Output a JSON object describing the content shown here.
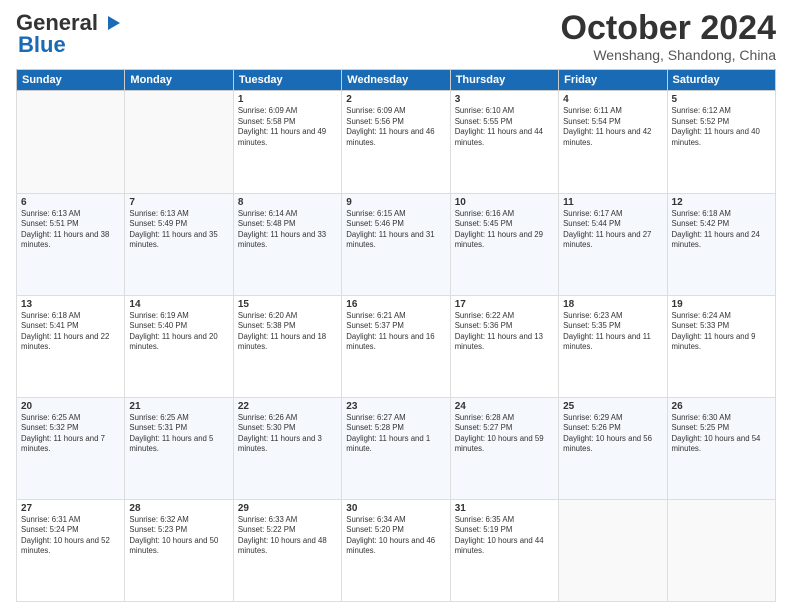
{
  "logo": {
    "general": "General",
    "blue": "Blue",
    "icon": "▶"
  },
  "header": {
    "month_title": "October 2024",
    "subtitle": "Wenshang, Shandong, China"
  },
  "days_of_week": [
    "Sunday",
    "Monday",
    "Tuesday",
    "Wednesday",
    "Thursday",
    "Friday",
    "Saturday"
  ],
  "weeks": [
    [
      {
        "day": "",
        "sunrise": "",
        "sunset": "",
        "daylight": ""
      },
      {
        "day": "",
        "sunrise": "",
        "sunset": "",
        "daylight": ""
      },
      {
        "day": "1",
        "sunrise": "Sunrise: 6:09 AM",
        "sunset": "Sunset: 5:58 PM",
        "daylight": "Daylight: 11 hours and 49 minutes."
      },
      {
        "day": "2",
        "sunrise": "Sunrise: 6:09 AM",
        "sunset": "Sunset: 5:56 PM",
        "daylight": "Daylight: 11 hours and 46 minutes."
      },
      {
        "day": "3",
        "sunrise": "Sunrise: 6:10 AM",
        "sunset": "Sunset: 5:55 PM",
        "daylight": "Daylight: 11 hours and 44 minutes."
      },
      {
        "day": "4",
        "sunrise": "Sunrise: 6:11 AM",
        "sunset": "Sunset: 5:54 PM",
        "daylight": "Daylight: 11 hours and 42 minutes."
      },
      {
        "day": "5",
        "sunrise": "Sunrise: 6:12 AM",
        "sunset": "Sunset: 5:52 PM",
        "daylight": "Daylight: 11 hours and 40 minutes."
      }
    ],
    [
      {
        "day": "6",
        "sunrise": "Sunrise: 6:13 AM",
        "sunset": "Sunset: 5:51 PM",
        "daylight": "Daylight: 11 hours and 38 minutes."
      },
      {
        "day": "7",
        "sunrise": "Sunrise: 6:13 AM",
        "sunset": "Sunset: 5:49 PM",
        "daylight": "Daylight: 11 hours and 35 minutes."
      },
      {
        "day": "8",
        "sunrise": "Sunrise: 6:14 AM",
        "sunset": "Sunset: 5:48 PM",
        "daylight": "Daylight: 11 hours and 33 minutes."
      },
      {
        "day": "9",
        "sunrise": "Sunrise: 6:15 AM",
        "sunset": "Sunset: 5:46 PM",
        "daylight": "Daylight: 11 hours and 31 minutes."
      },
      {
        "day": "10",
        "sunrise": "Sunrise: 6:16 AM",
        "sunset": "Sunset: 5:45 PM",
        "daylight": "Daylight: 11 hours and 29 minutes."
      },
      {
        "day": "11",
        "sunrise": "Sunrise: 6:17 AM",
        "sunset": "Sunset: 5:44 PM",
        "daylight": "Daylight: 11 hours and 27 minutes."
      },
      {
        "day": "12",
        "sunrise": "Sunrise: 6:18 AM",
        "sunset": "Sunset: 5:42 PM",
        "daylight": "Daylight: 11 hours and 24 minutes."
      }
    ],
    [
      {
        "day": "13",
        "sunrise": "Sunrise: 6:18 AM",
        "sunset": "Sunset: 5:41 PM",
        "daylight": "Daylight: 11 hours and 22 minutes."
      },
      {
        "day": "14",
        "sunrise": "Sunrise: 6:19 AM",
        "sunset": "Sunset: 5:40 PM",
        "daylight": "Daylight: 11 hours and 20 minutes."
      },
      {
        "day": "15",
        "sunrise": "Sunrise: 6:20 AM",
        "sunset": "Sunset: 5:38 PM",
        "daylight": "Daylight: 11 hours and 18 minutes."
      },
      {
        "day": "16",
        "sunrise": "Sunrise: 6:21 AM",
        "sunset": "Sunset: 5:37 PM",
        "daylight": "Daylight: 11 hours and 16 minutes."
      },
      {
        "day": "17",
        "sunrise": "Sunrise: 6:22 AM",
        "sunset": "Sunset: 5:36 PM",
        "daylight": "Daylight: 11 hours and 13 minutes."
      },
      {
        "day": "18",
        "sunrise": "Sunrise: 6:23 AM",
        "sunset": "Sunset: 5:35 PM",
        "daylight": "Daylight: 11 hours and 11 minutes."
      },
      {
        "day": "19",
        "sunrise": "Sunrise: 6:24 AM",
        "sunset": "Sunset: 5:33 PM",
        "daylight": "Daylight: 11 hours and 9 minutes."
      }
    ],
    [
      {
        "day": "20",
        "sunrise": "Sunrise: 6:25 AM",
        "sunset": "Sunset: 5:32 PM",
        "daylight": "Daylight: 11 hours and 7 minutes."
      },
      {
        "day": "21",
        "sunrise": "Sunrise: 6:25 AM",
        "sunset": "Sunset: 5:31 PM",
        "daylight": "Daylight: 11 hours and 5 minutes."
      },
      {
        "day": "22",
        "sunrise": "Sunrise: 6:26 AM",
        "sunset": "Sunset: 5:30 PM",
        "daylight": "Daylight: 11 hours and 3 minutes."
      },
      {
        "day": "23",
        "sunrise": "Sunrise: 6:27 AM",
        "sunset": "Sunset: 5:28 PM",
        "daylight": "Daylight: 11 hours and 1 minute."
      },
      {
        "day": "24",
        "sunrise": "Sunrise: 6:28 AM",
        "sunset": "Sunset: 5:27 PM",
        "daylight": "Daylight: 10 hours and 59 minutes."
      },
      {
        "day": "25",
        "sunrise": "Sunrise: 6:29 AM",
        "sunset": "Sunset: 5:26 PM",
        "daylight": "Daylight: 10 hours and 56 minutes."
      },
      {
        "day": "26",
        "sunrise": "Sunrise: 6:30 AM",
        "sunset": "Sunset: 5:25 PM",
        "daylight": "Daylight: 10 hours and 54 minutes."
      }
    ],
    [
      {
        "day": "27",
        "sunrise": "Sunrise: 6:31 AM",
        "sunset": "Sunset: 5:24 PM",
        "daylight": "Daylight: 10 hours and 52 minutes."
      },
      {
        "day": "28",
        "sunrise": "Sunrise: 6:32 AM",
        "sunset": "Sunset: 5:23 PM",
        "daylight": "Daylight: 10 hours and 50 minutes."
      },
      {
        "day": "29",
        "sunrise": "Sunrise: 6:33 AM",
        "sunset": "Sunset: 5:22 PM",
        "daylight": "Daylight: 10 hours and 48 minutes."
      },
      {
        "day": "30",
        "sunrise": "Sunrise: 6:34 AM",
        "sunset": "Sunset: 5:20 PM",
        "daylight": "Daylight: 10 hours and 46 minutes."
      },
      {
        "day": "31",
        "sunrise": "Sunrise: 6:35 AM",
        "sunset": "Sunset: 5:19 PM",
        "daylight": "Daylight: 10 hours and 44 minutes."
      },
      {
        "day": "",
        "sunrise": "",
        "sunset": "",
        "daylight": ""
      },
      {
        "day": "",
        "sunrise": "",
        "sunset": "",
        "daylight": ""
      }
    ]
  ]
}
